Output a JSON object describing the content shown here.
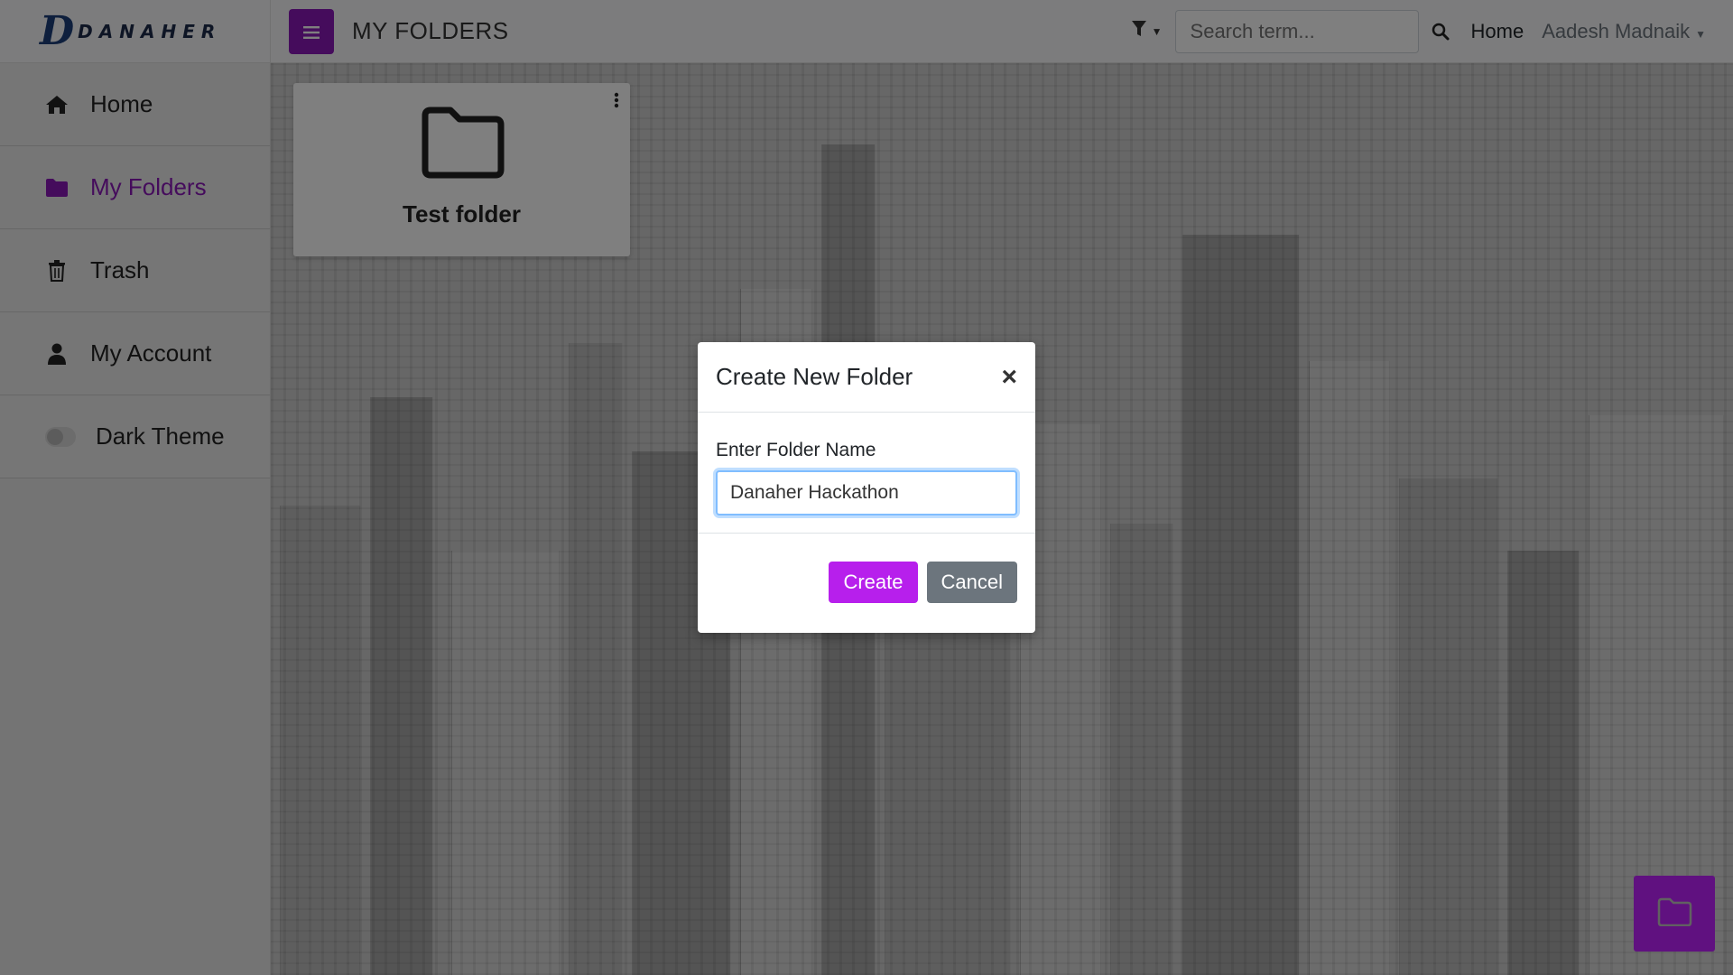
{
  "brand": {
    "mark": "D",
    "text": "DANAHER"
  },
  "header": {
    "title": "MY FOLDERS",
    "search_placeholder": "Search term...",
    "home_label": "Home",
    "user_name": "Aadesh Madnaik"
  },
  "sidebar": {
    "items": [
      {
        "label": "Home",
        "icon": "home-icon"
      },
      {
        "label": "My Folders",
        "icon": "folder-icon",
        "active": true
      },
      {
        "label": "Trash",
        "icon": "trash-icon"
      },
      {
        "label": "My Account",
        "icon": "user-icon"
      },
      {
        "label": "Dark Theme",
        "icon": "toggle-switch"
      }
    ]
  },
  "folders": [
    {
      "name": "Test folder"
    }
  ],
  "modal": {
    "title": "Create New Folder",
    "close_symbol": "×",
    "field_label": "Enter Folder Name",
    "field_value": "Danaher Hackathon",
    "create_label": "Create",
    "cancel_label": "Cancel"
  },
  "colors": {
    "accent": "#8a19b8",
    "create_button": "#b71fec",
    "cancel_button": "#6c757d"
  }
}
